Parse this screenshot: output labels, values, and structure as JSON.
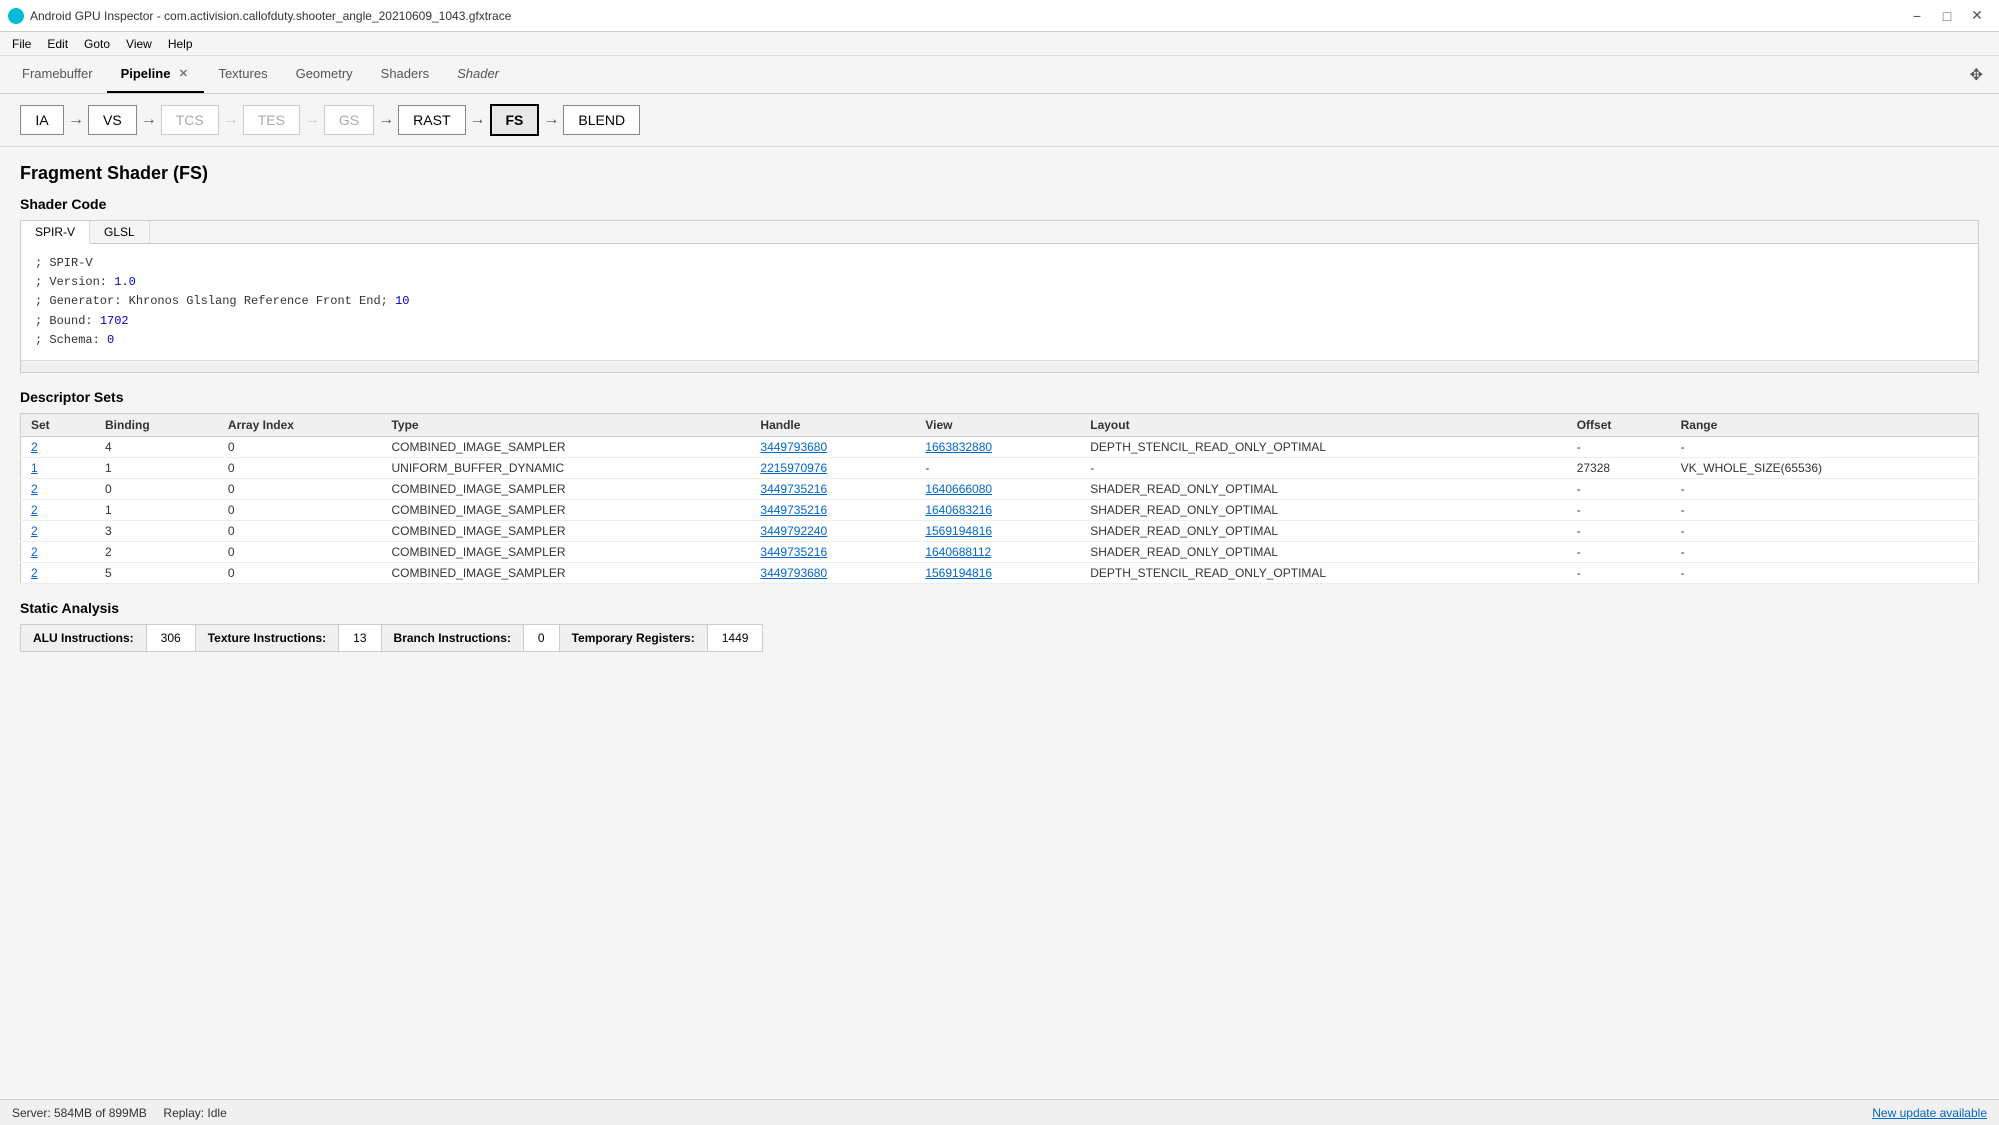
{
  "titleBar": {
    "title": "Android GPU Inspector - com.activision.callofduty.shooter_angle_20210609_1043.gfxtrace",
    "iconColor": "#00bcd4",
    "controls": [
      "minimize",
      "maximize",
      "close"
    ]
  },
  "menuBar": {
    "items": [
      "File",
      "Edit",
      "Goto",
      "View",
      "Help"
    ]
  },
  "tabs": [
    {
      "id": "framebuffer",
      "label": "Framebuffer",
      "active": false,
      "closeable": false
    },
    {
      "id": "pipeline",
      "label": "Pipeline",
      "active": true,
      "closeable": true
    },
    {
      "id": "textures",
      "label": "Textures",
      "active": false,
      "closeable": false
    },
    {
      "id": "geometry",
      "label": "Geometry",
      "active": false,
      "closeable": false
    },
    {
      "id": "shaders",
      "label": "Shaders",
      "active": false,
      "closeable": false
    },
    {
      "id": "shader",
      "label": "Shader",
      "active": false,
      "closeable": false,
      "italic": true
    }
  ],
  "pipeline": {
    "stages": [
      {
        "id": "IA",
        "label": "IA",
        "active": false,
        "dimmed": false
      },
      {
        "id": "VS",
        "label": "VS",
        "active": false,
        "dimmed": false
      },
      {
        "id": "TCS",
        "label": "TCS",
        "active": false,
        "dimmed": true
      },
      {
        "id": "TES",
        "label": "TES",
        "active": false,
        "dimmed": true
      },
      {
        "id": "GS",
        "label": "GS",
        "active": false,
        "dimmed": true
      },
      {
        "id": "RAST",
        "label": "RAST",
        "active": false,
        "dimmed": false
      },
      {
        "id": "FS",
        "label": "FS",
        "active": true,
        "dimmed": false
      },
      {
        "id": "BLEND",
        "label": "BLEND",
        "active": false,
        "dimmed": false
      }
    ]
  },
  "fragmentShader": {
    "title": "Fragment Shader (FS)",
    "shaderCode": {
      "title": "Shader Code",
      "tabs": [
        "SPIR-V",
        "GLSL"
      ],
      "activeTab": "SPIR-V",
      "lines": [
        "; SPIR-V",
        "; Version: 1.0",
        "; Generator: Khronos Glslang Reference Front End; 10",
        "; Bound: 1702",
        "; Schema: 0"
      ],
      "highlightedNumbers": [
        "1.0",
        "10",
        "1702",
        "0"
      ]
    },
    "descriptorSets": {
      "title": "Descriptor Sets",
      "columns": [
        "Set",
        "Binding",
        "Array Index",
        "Type",
        "Handle",
        "View",
        "Layout",
        "Offset",
        "Range"
      ],
      "rows": [
        {
          "set": "2",
          "binding": "4",
          "arrayIndex": "0",
          "type": "COMBINED_IMAGE_SAMPLER",
          "handle": "3449793680",
          "view": "1663832880",
          "layout": "DEPTH_STENCIL_READ_ONLY_OPTIMAL",
          "offset": "-",
          "range": "-"
        },
        {
          "set": "1",
          "binding": "1",
          "arrayIndex": "0",
          "type": "UNIFORM_BUFFER_DYNAMIC",
          "handle": "2215970976",
          "view": "-",
          "layout": "-",
          "offset": "27328",
          "range": "VK_WHOLE_SIZE(65536)"
        },
        {
          "set": "2",
          "binding": "0",
          "arrayIndex": "0",
          "type": "COMBINED_IMAGE_SAMPLER",
          "handle": "3449735216",
          "view": "1640666080",
          "layout": "SHADER_READ_ONLY_OPTIMAL",
          "offset": "-",
          "range": "-"
        },
        {
          "set": "2",
          "binding": "1",
          "arrayIndex": "0",
          "type": "COMBINED_IMAGE_SAMPLER",
          "handle": "3449735216",
          "view": "1640683216",
          "layout": "SHADER_READ_ONLY_OPTIMAL",
          "offset": "-",
          "range": "-"
        },
        {
          "set": "2",
          "binding": "3",
          "arrayIndex": "0",
          "type": "COMBINED_IMAGE_SAMPLER",
          "handle": "3449792240",
          "view": "1569194816",
          "layout": "SHADER_READ_ONLY_OPTIMAL",
          "offset": "-",
          "range": "-"
        },
        {
          "set": "2",
          "binding": "2",
          "arrayIndex": "0",
          "type": "COMBINED_IMAGE_SAMPLER",
          "handle": "3449735216",
          "view": "1640688112",
          "layout": "SHADER_READ_ONLY_OPTIMAL",
          "offset": "-",
          "range": "-"
        },
        {
          "set": "2",
          "binding": "5",
          "arrayIndex": "0",
          "type": "COMBINED_IMAGE_SAMPLER",
          "handle": "3449793680",
          "view": "1569194816",
          "layout": "DEPTH_STENCIL_READ_ONLY_OPTIMAL",
          "offset": "-",
          "range": "-"
        }
      ]
    },
    "staticAnalysis": {
      "title": "Static Analysis",
      "stats": [
        {
          "label": "ALU Instructions:",
          "value": "306"
        },
        {
          "label": "Texture Instructions:",
          "value": "13"
        },
        {
          "label": "Branch Instructions:",
          "value": "0"
        },
        {
          "label": "Temporary Registers:",
          "value": "1449"
        }
      ]
    }
  },
  "statusBar": {
    "server": "Server: 584MB of 899MB",
    "replay": "Replay: Idle",
    "update": "New update available"
  }
}
